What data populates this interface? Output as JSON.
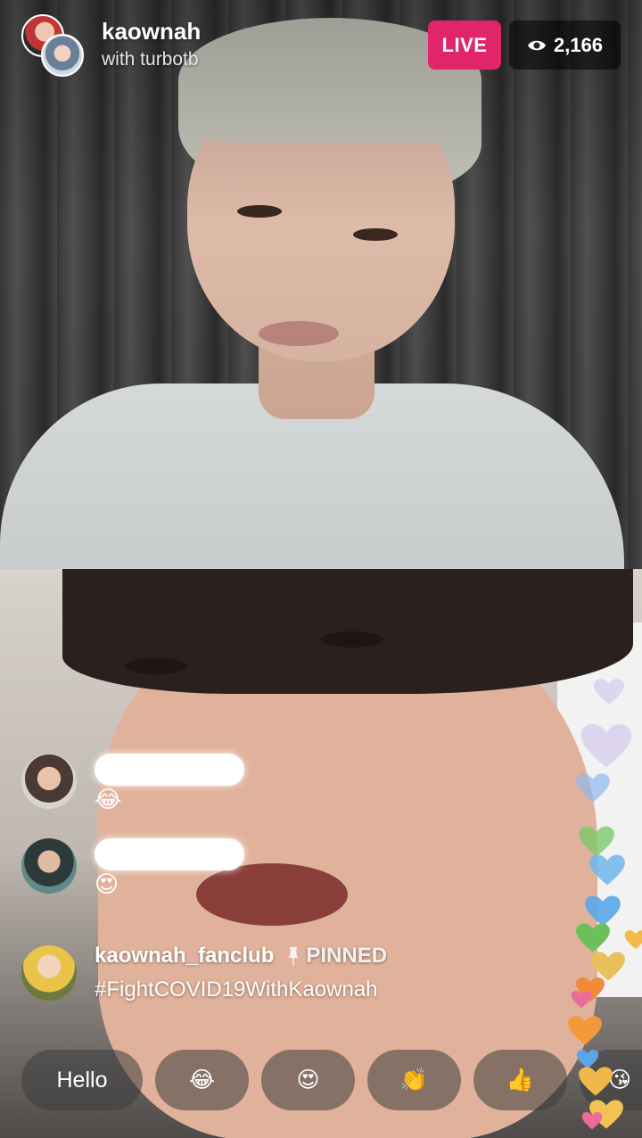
{
  "host": {
    "name": "kaownah",
    "with_text": "with turbotb"
  },
  "live_label": "LIVE",
  "viewer_count": "2,166",
  "comments": [
    {
      "emoji": "😂"
    },
    {
      "emoji": "😍"
    }
  ],
  "pinned": {
    "user": "kaownah_fanclub",
    "label": "PINNED",
    "text": "#FightCOVID19WithKaownah"
  },
  "quick_replies": [
    "Hello",
    "😂",
    "😍",
    "👏",
    "👍",
    "😘"
  ],
  "colors": {
    "live": "#e1256a",
    "hearts": [
      "#b3a8e8",
      "#6fb7ea",
      "#7cc96a",
      "#f3b94a",
      "#f08a3a",
      "#e96c9a"
    ]
  },
  "icons": {
    "viewers": "eye-icon",
    "pin": "pin-icon"
  }
}
